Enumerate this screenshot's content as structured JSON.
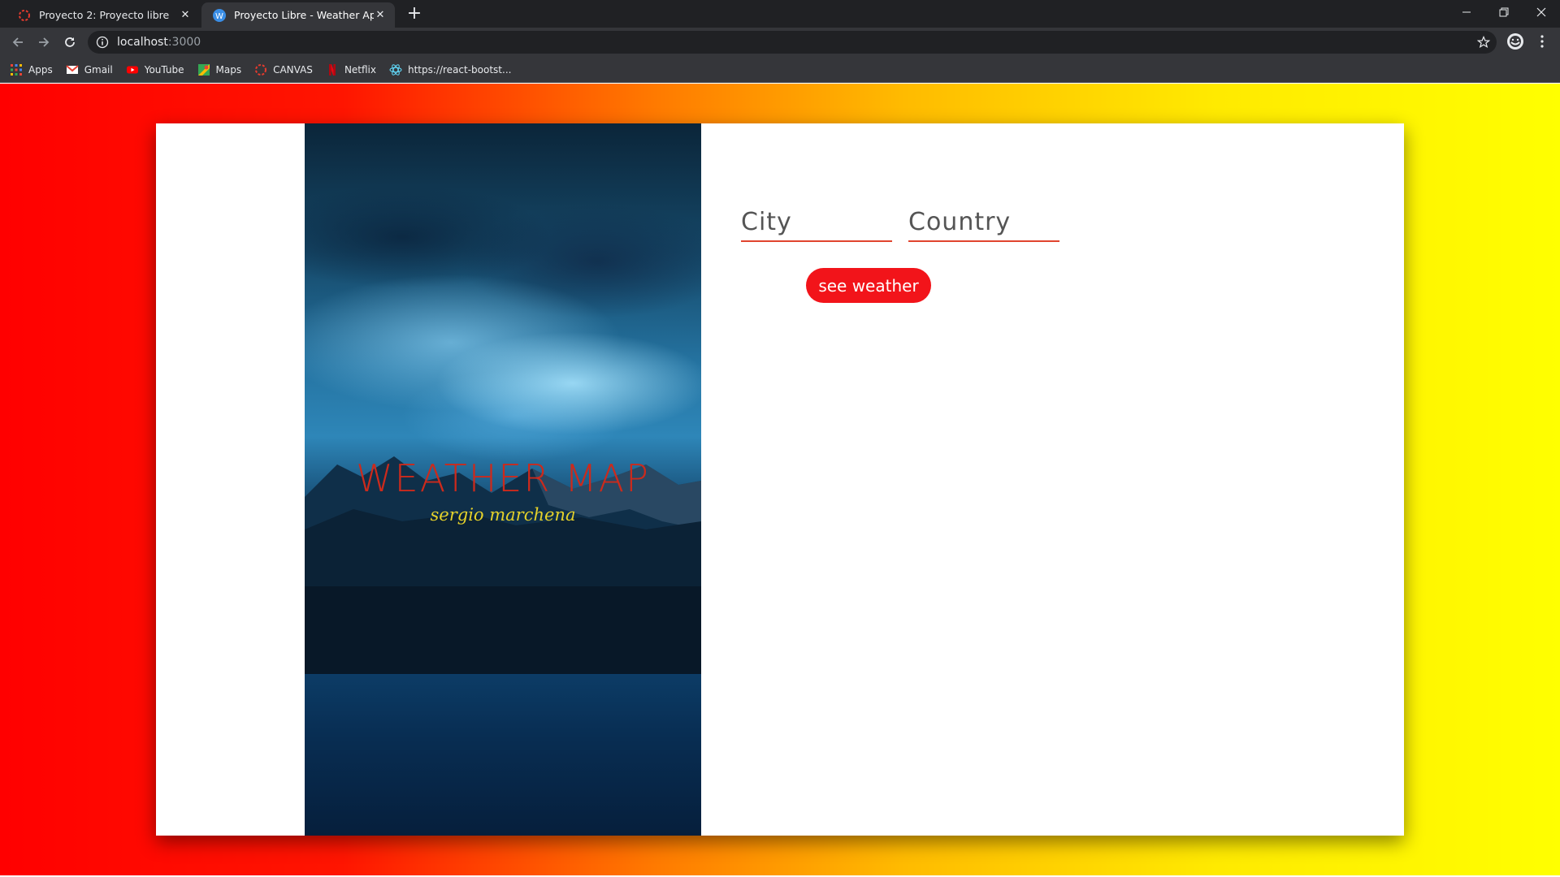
{
  "browser": {
    "tabs": [
      {
        "title": "Proyecto 2: Proyecto libre",
        "icon": "canvas-icon"
      },
      {
        "title": "Proyecto Libre - Weather App",
        "icon": "weather-app-icon"
      }
    ],
    "address": {
      "host": "localhost",
      "port": ":3000"
    },
    "bookmarks": [
      {
        "label": "Apps",
        "icon": "apps-grid-icon"
      },
      {
        "label": "Gmail",
        "icon": "gmail-icon"
      },
      {
        "label": "YouTube",
        "icon": "youtube-icon"
      },
      {
        "label": "Maps",
        "icon": "maps-icon"
      },
      {
        "label": "CANVAS",
        "icon": "canvas-icon"
      },
      {
        "label": "Netflix",
        "icon": "netflix-icon"
      },
      {
        "label": "https://react-bootst...",
        "icon": "react-bootstrap-icon"
      }
    ]
  },
  "app": {
    "title": "WEATHER MAP",
    "subtitle": "sergio marchena",
    "form": {
      "city_placeholder": "City",
      "country_placeholder": "Country",
      "submit_label": "see weather"
    },
    "colors": {
      "gradient_start": "#ff0000",
      "gradient_end": "#ffff00",
      "button": "#f2141a",
      "title": "#cc2a1c",
      "subtitle": "#e6d22a"
    }
  }
}
